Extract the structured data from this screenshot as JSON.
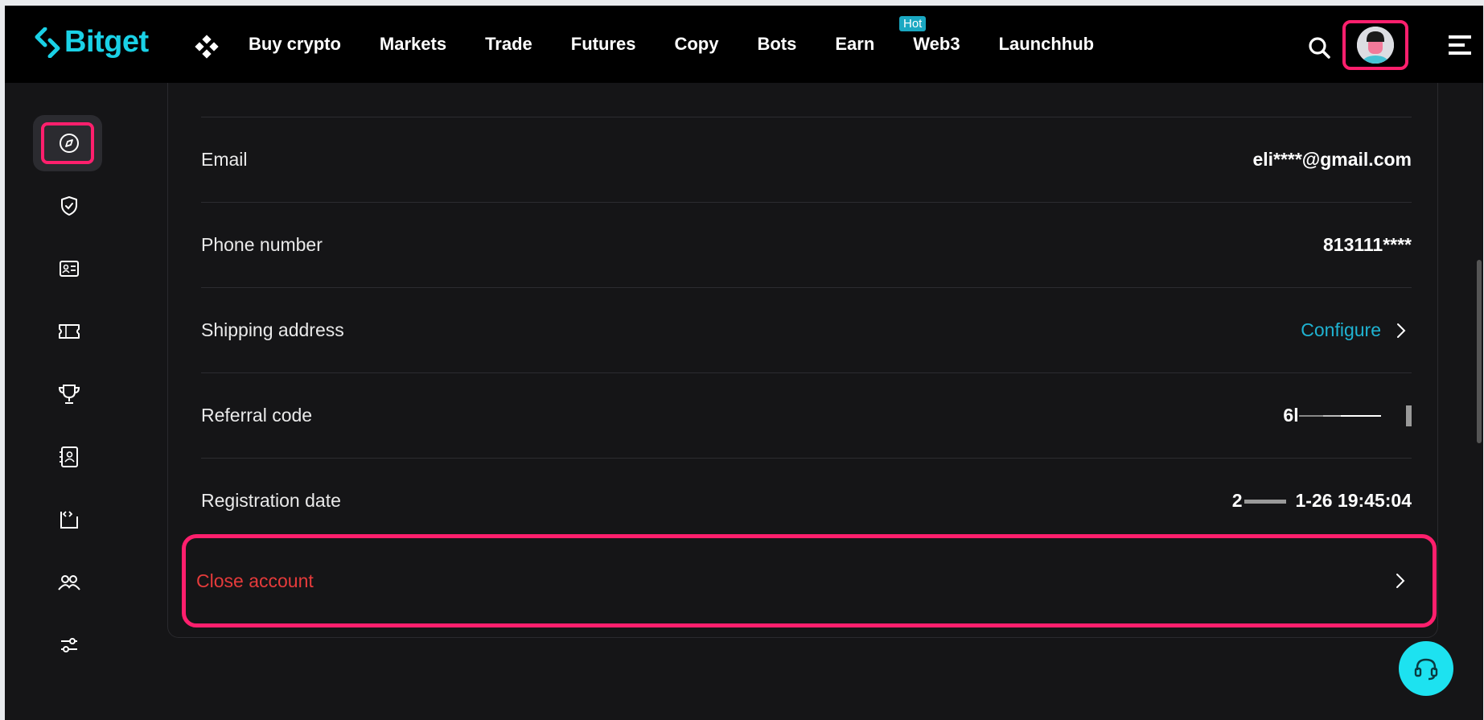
{
  "brand": {
    "name": "Bitget",
    "color": "#1ad1e6"
  },
  "nav": {
    "items": [
      "Buy crypto",
      "Markets",
      "Trade",
      "Futures",
      "Copy",
      "Bots",
      "Earn",
      "Web3",
      "Launchhub"
    ],
    "hot_badge": "Hot"
  },
  "header_icons": [
    "apps-icon",
    "search-icon",
    "avatar",
    "menu-icon"
  ],
  "sidebar": {
    "icons": [
      "compass-icon",
      "shield-check-icon",
      "id-card-icon",
      "ticket-icon",
      "trophy-icon",
      "contacts-icon",
      "api-icon",
      "users-icon",
      "sliders-icon"
    ],
    "active": "compass-icon"
  },
  "profile": {
    "email_label": "Email",
    "email_value": "eli****@gmail.com",
    "phone_label": "Phone number",
    "phone_value": "813111****",
    "shipping_label": "Shipping address",
    "shipping_action": "Configure",
    "referral_label": "Referral code",
    "referral_value": "6l",
    "registration_label": "Registration date",
    "registration_prefix": "2",
    "registration_value": "1-26 19:45:04",
    "close_label": "Close account"
  },
  "colors": {
    "accent": "#1ad1e6",
    "highlight": "#ff1f6d",
    "danger": "#e53b3b",
    "link": "#1fb3d2"
  },
  "support": {
    "icon": "headset-icon"
  }
}
